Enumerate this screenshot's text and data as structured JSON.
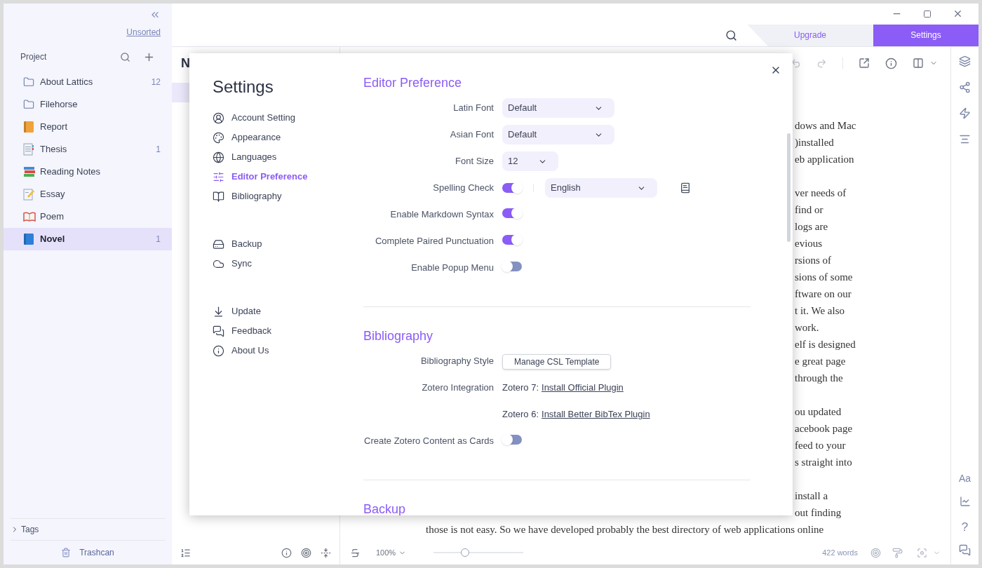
{
  "sidebar": {
    "unsorted_link": "Unsorted",
    "section_title": "Project",
    "items": [
      {
        "label": "About Lattics",
        "count": "12",
        "kind": "folder",
        "selected": false
      },
      {
        "label": "Filehorse",
        "kind": "folder",
        "selected": false
      },
      {
        "label": "Report",
        "kind": "notebook",
        "selected": false
      },
      {
        "label": "Thesis",
        "count": "1",
        "kind": "document",
        "selected": false
      },
      {
        "label": "Reading Notes",
        "kind": "books",
        "selected": false
      },
      {
        "label": "Essay",
        "kind": "memo",
        "selected": false
      },
      {
        "label": "Poem",
        "kind": "openbook",
        "selected": false
      },
      {
        "label": "Novel",
        "count": "1",
        "kind": "journal",
        "selected": true
      }
    ],
    "tags": "Tags",
    "trash": "Trashcan"
  },
  "top_bar": {
    "tabs": [
      {
        "label": "Upgrade",
        "selected": false
      },
      {
        "label": "Settings",
        "selected": true
      }
    ]
  },
  "note_list": {
    "title": "N",
    "items": [
      {
        "selected": true
      }
    ]
  },
  "document": {
    "paragraphs": [
      [
        "dows and Mac",
        ")installed",
        "eb application"
      ],
      [
        "ver needs of",
        "find or",
        "logs are",
        "evious",
        "rsions of",
        "sions of some",
        "ftware on our",
        "t it. We also",
        "work.",
        "elf is designed",
        "e great page",
        "through the"
      ],
      [
        "ou updated",
        "acebook page",
        "feed to your",
        "s straight into"
      ],
      [
        "install a",
        "out finding"
      ]
    ],
    "last_line": "those is not easy. So we have developed probably the best directory of web applications online"
  },
  "editor_status": {
    "zoom": "100%",
    "zoom_level": {
      "level": 0.35
    },
    "word_count": "422 words"
  },
  "right_rail": {
    "font_button": "Aa",
    "help_button": "?"
  },
  "settings_dialog": {
    "title": "Settings",
    "nav": [
      [
        {
          "label": "Account Setting",
          "kind": "account",
          "selected": false
        },
        {
          "label": "Appearance",
          "kind": "palette",
          "selected": false
        },
        {
          "label": "Languages",
          "kind": "globe",
          "selected": false
        },
        {
          "label": "Editor Preference",
          "kind": "sliders",
          "selected": true
        },
        {
          "label": "Bibliography",
          "kind": "book",
          "selected": false
        }
      ],
      [
        {
          "label": "Backup",
          "kind": "drive",
          "selected": false
        },
        {
          "label": "Sync",
          "kind": "cloud",
          "selected": false
        }
      ],
      [
        {
          "label": "Update",
          "kind": "download",
          "selected": false
        },
        {
          "label": "Feedback",
          "kind": "chat",
          "selected": false
        },
        {
          "label": "About Us",
          "kind": "info",
          "selected": false
        }
      ]
    ],
    "sections": [
      {
        "heading": "Editor Preference",
        "rows": [
          {
            "kind": "wideselect",
            "label": "Latin Font",
            "value": "Default"
          },
          {
            "kind": "wideselect",
            "label": "Asian Font",
            "value": "Default"
          },
          {
            "kind": "narrowselect",
            "label": "Font Size",
            "value": "12"
          },
          {
            "kind": "toggle-select",
            "label": "Spelling Check",
            "on": true,
            "value": "English"
          },
          {
            "kind": "toggle",
            "label": "Enable Markdown Syntax",
            "on": true
          },
          {
            "kind": "toggle",
            "label": "Complete Paired Punctuation",
            "on": true
          },
          {
            "kind": "toggle",
            "label": "Enable Popup Menu",
            "on": false
          }
        ]
      },
      {
        "heading": "Bibliography",
        "rows": [
          {
            "kind": "button",
            "label": "Bibliography Style",
            "value": "Manage CSL Template"
          },
          {
            "kind": "link",
            "label": "Zotero Integration",
            "prefix": "Zotero 7:",
            "link": "Install Official Plugin"
          },
          {
            "kind": "link",
            "prefix": "Zotero 6:",
            "link": "Install Better BibTex Plugin"
          },
          {
            "kind": "toggle",
            "label": "Create Zotero Content as Cards",
            "on": false
          }
        ]
      },
      {
        "heading": "Backup"
      }
    ]
  }
}
